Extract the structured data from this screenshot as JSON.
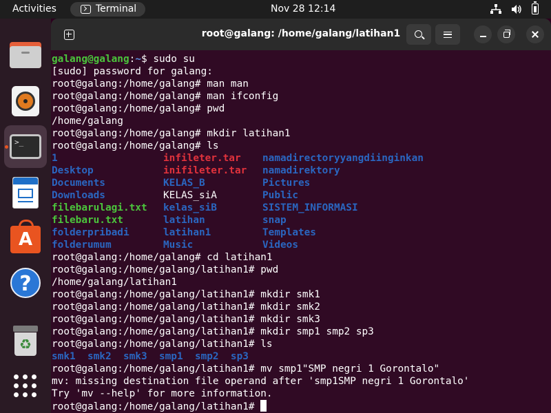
{
  "topbar": {
    "activities": "Activities",
    "app_label": "Terminal",
    "clock": "Nov 28  12:14"
  },
  "window": {
    "title": "root@galang: /home/galang/latihan1"
  },
  "terminal": {
    "lines": [
      {
        "type": "user",
        "user": "galang@galang",
        "path": "~",
        "symbol": "$",
        "cmd": " sudo su"
      },
      {
        "type": "out",
        "text": "[sudo] password for galang:"
      },
      {
        "type": "out",
        "text": "root@galang:/home/galang# man man"
      },
      {
        "type": "out",
        "text": "root@galang:/home/galang# man ifconfig"
      },
      {
        "type": "out",
        "text": "root@galang:/home/galang# pwd"
      },
      {
        "type": "out",
        "text": "/home/galang"
      },
      {
        "type": "out",
        "text": "root@galang:/home/galang# mkdir latihan1"
      },
      {
        "type": "out",
        "text": "root@galang:/home/galang# ls"
      },
      {
        "type": "ls3",
        "cells": [
          [
            "1",
            "dir"
          ],
          [
            "infileter.tar",
            "arc"
          ],
          [
            "namadirectoryyangdiinginkan",
            "dir"
          ]
        ]
      },
      {
        "type": "ls3",
        "cells": [
          [
            "Desktop",
            "dir"
          ],
          [
            "inifileter.tar",
            "arc"
          ],
          [
            "namadirektory",
            "dir"
          ]
        ]
      },
      {
        "type": "ls3",
        "cells": [
          [
            "Documents",
            "dir"
          ],
          [
            "KELAS_B",
            "dir"
          ],
          [
            "Pictures",
            "dir"
          ]
        ]
      },
      {
        "type": "ls3",
        "cells": [
          [
            "Downloads",
            "dir"
          ],
          [
            "KELAS_siA",
            "plain"
          ],
          [
            "Public",
            "dir"
          ]
        ]
      },
      {
        "type": "ls3",
        "cells": [
          [
            "filebarulagi.txt",
            "txt"
          ],
          [
            "kelas_siB",
            "dir"
          ],
          [
            "SISTEM_INFORMASI",
            "dir"
          ]
        ]
      },
      {
        "type": "ls3",
        "cells": [
          [
            "filebaru.txt",
            "txt"
          ],
          [
            "latihan",
            "dir"
          ],
          [
            "snap",
            "dir"
          ]
        ]
      },
      {
        "type": "ls3",
        "cells": [
          [
            "folderpribadi",
            "dir"
          ],
          [
            "latihan1",
            "dir"
          ],
          [
            "Templates",
            "dir"
          ]
        ]
      },
      {
        "type": "ls3",
        "cells": [
          [
            "folderumum",
            "dir"
          ],
          [
            "Music",
            "dir"
          ],
          [
            "Videos",
            "dir"
          ]
        ]
      },
      {
        "type": "out",
        "text": "root@galang:/home/galang# cd latihan1"
      },
      {
        "type": "out",
        "text": "root@galang:/home/galang/latihan1# pwd"
      },
      {
        "type": "out",
        "text": "/home/galang/latihan1"
      },
      {
        "type": "out",
        "text": "root@galang:/home/galang/latihan1# mkdir smk1"
      },
      {
        "type": "out",
        "text": "root@galang:/home/galang/latihan1# mkdir smk2"
      },
      {
        "type": "out",
        "text": "root@galang:/home/galang/latihan1# mkdir smk3"
      },
      {
        "type": "out",
        "text": "root@galang:/home/galang/latihan1# mkdir smp1 smp2 sp3"
      },
      {
        "type": "out",
        "text": "root@galang:/home/galang/latihan1# ls"
      },
      {
        "type": "lsrow",
        "items": [
          "smk1",
          "smk2",
          "smk3",
          "smp1",
          "smp2",
          "sp3"
        ]
      },
      {
        "type": "out",
        "text": "root@galang:/home/galang/latihan1# mv smp1\"SMP negri 1 Gorontalo\""
      },
      {
        "type": "out",
        "text": "mv: missing destination file operand after 'smp1SMP negri 1 Gorontalo'"
      },
      {
        "type": "out",
        "text": "Try 'mv --help' for more information."
      },
      {
        "type": "prompt",
        "text": "root@galang:/home/galang/latihan1# "
      }
    ]
  },
  "colors": {
    "terminal_bg": "#300a24",
    "directory": "#2a66c0",
    "archive": "#e0323c",
    "text_file": "#4bc43c",
    "accent": "#e95420"
  },
  "icons": {
    "dock": [
      "files-icon",
      "rhythmbox-icon",
      "terminal-icon",
      "writer-icon",
      "app-center-icon",
      "help-icon",
      "trash-icon",
      "show-apps-icon"
    ]
  }
}
